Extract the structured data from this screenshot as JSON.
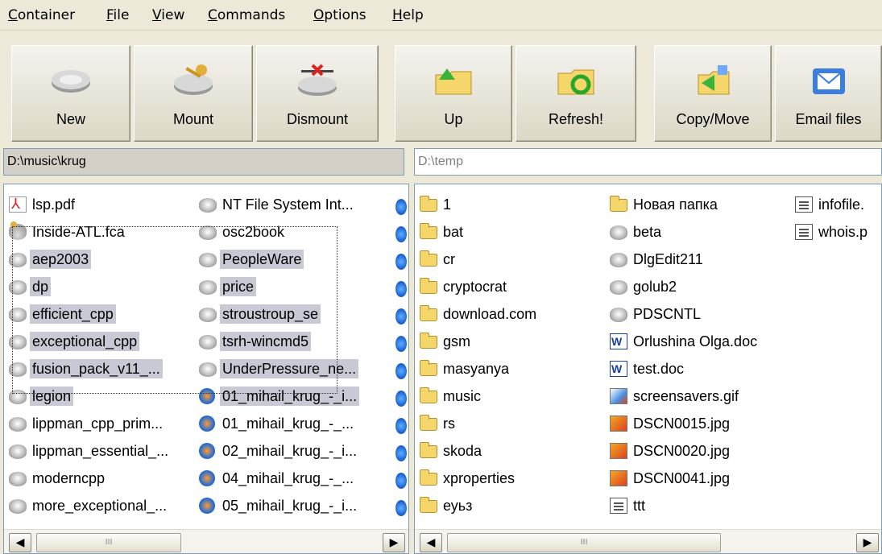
{
  "menu": [
    "Container",
    "File",
    "View",
    "Commands",
    "Options",
    "Help"
  ],
  "toolbar": {
    "buttons": [
      {
        "label": "New",
        "icon": "disk-drive-icon"
      },
      {
        "label": "Mount",
        "icon": "key-drive-icon"
      },
      {
        "label": "Dismount",
        "icon": "dismount-drive-icon"
      },
      {
        "label": "Up",
        "icon": "folder-up-icon"
      },
      {
        "label": "Refresh!",
        "icon": "folder-refresh-icon"
      },
      {
        "label": "Copy/Move",
        "icon": "folder-copy-icon"
      },
      {
        "label": "Email files",
        "icon": "email-icon"
      }
    ]
  },
  "left_panel": {
    "path": "D:\\music\\krug",
    "col1": [
      {
        "name": "lsp.pdf",
        "icon": "pdf"
      },
      {
        "name": "Inside-ATL.fca",
        "icon": "key"
      },
      {
        "name": "aep2003",
        "icon": "disk",
        "sel": true
      },
      {
        "name": "dp",
        "icon": "disk",
        "sel": true
      },
      {
        "name": "efficient_cpp",
        "icon": "disk",
        "sel": true
      },
      {
        "name": "exceptional_cpp",
        "icon": "disk",
        "sel": true
      },
      {
        "name": "fusion_pack_v11_...",
        "icon": "disk",
        "sel": true
      },
      {
        "name": "legion",
        "icon": "disk",
        "sel": true
      },
      {
        "name": "lippman_cpp_prim...",
        "icon": "disk"
      },
      {
        "name": "lippman_essential_...",
        "icon": "disk"
      },
      {
        "name": "moderncpp",
        "icon": "disk"
      },
      {
        "name": "more_exceptional_...",
        "icon": "disk"
      }
    ],
    "col2": [
      {
        "name": "NT File System Int...",
        "icon": "disk"
      },
      {
        "name": "osc2book",
        "icon": "disk"
      },
      {
        "name": "PeopleWare",
        "icon": "disk",
        "sel": true
      },
      {
        "name": "price",
        "icon": "disk",
        "sel": true
      },
      {
        "name": "stroustroup_se",
        "icon": "disk",
        "sel": true
      },
      {
        "name": "tsrh-wincmd5",
        "icon": "disk",
        "sel": true
      },
      {
        "name": "UnderPressure_ne...",
        "icon": "disk",
        "sel": true
      },
      {
        "name": "01_mihail_krug_-_i...",
        "icon": "media",
        "sel": true
      },
      {
        "name": "01_mihail_krug_-_...",
        "icon": "media"
      },
      {
        "name": "02_mihail_krug_-_i...",
        "icon": "media"
      },
      {
        "name": "04_mihail_krug_-_...",
        "icon": "media"
      },
      {
        "name": "05_mihail_krug_-_i...",
        "icon": "media"
      }
    ]
  },
  "right_panel": {
    "path": "D:\\temp",
    "col1": [
      {
        "name": "1",
        "icon": "folder"
      },
      {
        "name": "bat",
        "icon": "folder"
      },
      {
        "name": "cr",
        "icon": "folder"
      },
      {
        "name": "cryptocrat",
        "icon": "folder"
      },
      {
        "name": "download.com",
        "icon": "folder"
      },
      {
        "name": "gsm",
        "icon": "folder"
      },
      {
        "name": "masyanya",
        "icon": "folder"
      },
      {
        "name": "music",
        "icon": "folder"
      },
      {
        "name": "rs",
        "icon": "folder"
      },
      {
        "name": "skoda",
        "icon": "folder"
      },
      {
        "name": "xproperties",
        "icon": "folder"
      },
      {
        "name": "еуьз",
        "icon": "folder"
      }
    ],
    "col2": [
      {
        "name": "Новая папка",
        "icon": "folder"
      },
      {
        "name": "beta",
        "icon": "disk"
      },
      {
        "name": "DlgEdit211",
        "icon": "disk"
      },
      {
        "name": "golub2",
        "icon": "disk"
      },
      {
        "name": "PDSCNTL",
        "icon": "disk"
      },
      {
        "name": "Orlushina Olga.doc",
        "icon": "doc"
      },
      {
        "name": "test.doc",
        "icon": "doc"
      },
      {
        "name": "screensavers.gif",
        "icon": "gif"
      },
      {
        "name": "DSCN0015.jpg",
        "icon": "img"
      },
      {
        "name": "DSCN0020.jpg",
        "icon": "img"
      },
      {
        "name": "DSCN0041.jpg",
        "icon": "img"
      },
      {
        "name": "ttt",
        "icon": "txt"
      }
    ],
    "col3": [
      {
        "name": "infofile.",
        "icon": "txt"
      },
      {
        "name": "whois.p",
        "icon": "txt"
      }
    ]
  },
  "scroll": {
    "left": "◀",
    "right": "▶",
    "grip": "III"
  }
}
